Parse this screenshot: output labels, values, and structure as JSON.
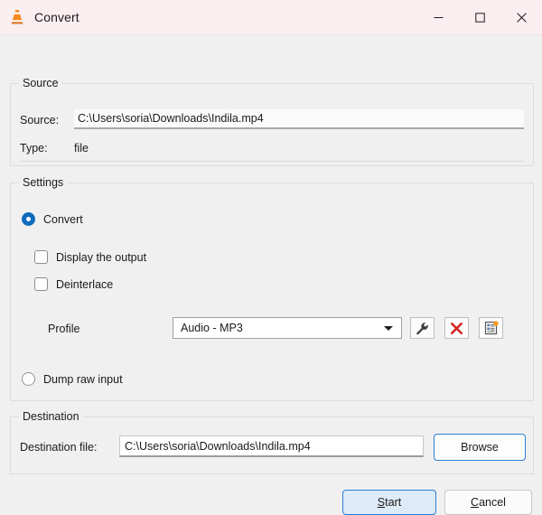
{
  "window": {
    "title": "Convert",
    "icon": "vlc-cone-icon",
    "controls": {
      "minimize": "minimize-icon",
      "maximize": "maximize-icon",
      "close": "close-icon"
    }
  },
  "source": {
    "legend": "Source",
    "source_label": "Source:",
    "source_value": "C:\\Users\\soria\\Downloads\\Indila.mp4",
    "type_label": "Type:",
    "type_value": "file"
  },
  "settings": {
    "legend": "Settings",
    "convert_radio": {
      "label": "Convert",
      "selected": true
    },
    "display_output_checkbox": {
      "label": "Display the output",
      "checked": false
    },
    "deinterlace_checkbox": {
      "label": "Deinterlace",
      "checked": false
    },
    "profile_label": "Profile",
    "profile_value": "Audio - MP3",
    "profile_buttons": {
      "edit": "wrench-icon",
      "delete": "red-x-icon",
      "new": "new-profile-icon"
    },
    "dump_radio": {
      "label": "Dump raw input",
      "selected": false
    }
  },
  "destination": {
    "legend": "Destination",
    "file_label": "Destination file:",
    "file_value": "C:\\Users\\soria\\Downloads\\Indila.mp4",
    "browse_label": "Browse"
  },
  "actions": {
    "start_accel": "S",
    "start_rest": "tart",
    "cancel_accel": "C",
    "cancel_rest": "ancel"
  },
  "colors": {
    "accent_blue": "#0f6cbd",
    "focus_border": "#2b7fd4",
    "delete_red": "#d32020",
    "titlebar_tint": "#faeef0",
    "window_bg": "#f0f0f0"
  }
}
